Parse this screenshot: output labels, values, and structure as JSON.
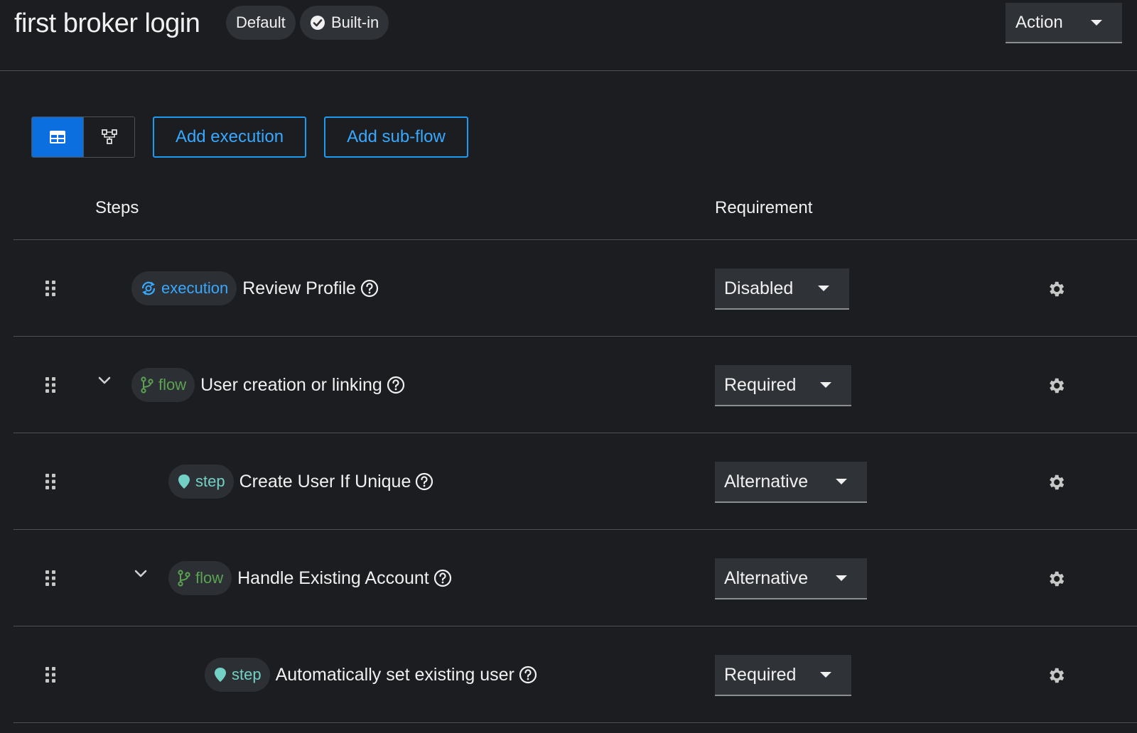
{
  "header": {
    "title": "first broker login",
    "chips": {
      "default": "Default",
      "builtin": "Built-in"
    },
    "action_label": "Action"
  },
  "toolbar": {
    "add_execution": "Add execution",
    "add_subflow": "Add sub-flow",
    "view_table_icon": "table-icon",
    "view_diagram_icon": "diagram-icon"
  },
  "table": {
    "columns": {
      "steps": "Steps",
      "requirement": "Requirement"
    },
    "rows": [
      {
        "type": "execution",
        "badge": "execution",
        "name": "Review Profile",
        "requirement": "Disabled",
        "expandable": false
      },
      {
        "type": "flow",
        "badge": "flow",
        "name": "User creation or linking",
        "requirement": "Required",
        "expandable": true
      },
      {
        "type": "step",
        "badge": "step",
        "name": "Create User If Unique",
        "requirement": "Alternative",
        "expandable": false
      },
      {
        "type": "flow",
        "badge": "flow",
        "name": "Handle Existing Account",
        "requirement": "Alternative",
        "expandable": true
      },
      {
        "type": "step",
        "badge": "step",
        "name": "Automatically set existing user",
        "requirement": "Required",
        "expandable": false
      }
    ]
  },
  "colors": {
    "background": "#1b1d21",
    "primary": "#0c6fe0",
    "link_blue": "#38a8ff",
    "flow_green": "#5ba352",
    "step_teal": "#72d1c4"
  }
}
